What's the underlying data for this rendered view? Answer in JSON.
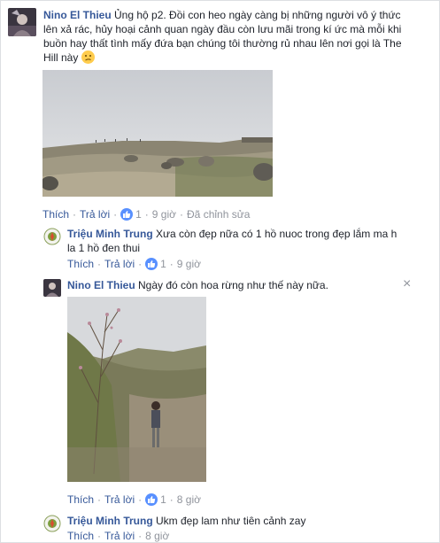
{
  "comments": [
    {
      "author": "Nino El Thieu",
      "text": "Ủng hộ p2. Đồi con heo ngày càng bị những người vô ý thức lên xả rác, hủy hoại cảnh quan ngày đầu còn lưu mãi trong kí ức mà mỗi khi buồn hay thất tình mấy đứa bạn chúng tôi thường rủ nhau lên nơi gọi là The Hill này",
      "emoji": "confused-face-emoji",
      "like_label": "Thích",
      "reply_label": "Trả lời",
      "reaction_count": "1",
      "time": "9 giờ",
      "edited_label": "Đã chỉnh sửa"
    },
    {
      "author": "Triệu Minh Trung",
      "text": "Xưa còn đẹp nữa có 1 hồ nuoc trong đẹp lắm ma h la 1 hồ đen thui",
      "like_label": "Thích",
      "reply_label": "Trả lời",
      "reaction_count": "1",
      "time": "9 giờ"
    },
    {
      "author": "Nino El Thieu",
      "text": "Ngày đó còn hoa rừng như thế này nữa.",
      "close_icon": "×",
      "like_label": "Thích",
      "reply_label": "Trả lời",
      "reaction_count": "1",
      "time": "8 giờ"
    },
    {
      "author": "Triệu Minh Trung",
      "text": "Ukm đẹp lam như tiên cảnh zay",
      "like_label": "Thích",
      "reply_label": "Trả lời",
      "time": "8 giờ"
    }
  ],
  "colors": {
    "link": "#365899",
    "text": "#1d2129",
    "meta": "#90949c",
    "like_badge": "#5890ff"
  },
  "icons": {
    "like": "thumbs-up-icon",
    "close": "close-icon"
  }
}
